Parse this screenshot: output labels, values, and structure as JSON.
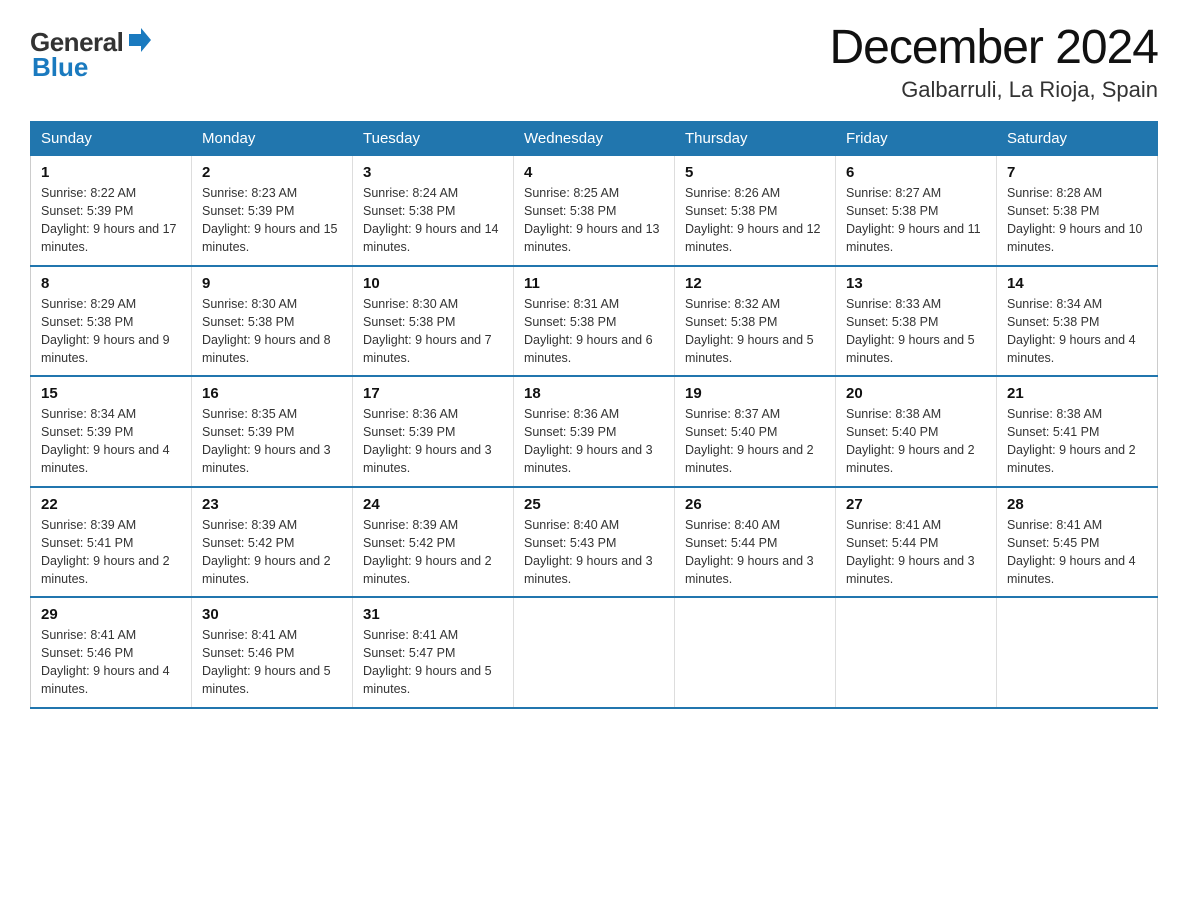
{
  "logo": {
    "general": "General",
    "blue": "Blue",
    "arrow_color": "#1a7abf"
  },
  "title": "December 2024",
  "subtitle": "Galbarruli, La Rioja, Spain",
  "days_of_week": [
    "Sunday",
    "Monday",
    "Tuesday",
    "Wednesday",
    "Thursday",
    "Friday",
    "Saturday"
  ],
  "weeks": [
    [
      {
        "day": "1",
        "sunrise": "8:22 AM",
        "sunset": "5:39 PM",
        "daylight": "9 hours and 17 minutes."
      },
      {
        "day": "2",
        "sunrise": "8:23 AM",
        "sunset": "5:39 PM",
        "daylight": "9 hours and 15 minutes."
      },
      {
        "day": "3",
        "sunrise": "8:24 AM",
        "sunset": "5:38 PM",
        "daylight": "9 hours and 14 minutes."
      },
      {
        "day": "4",
        "sunrise": "8:25 AM",
        "sunset": "5:38 PM",
        "daylight": "9 hours and 13 minutes."
      },
      {
        "day": "5",
        "sunrise": "8:26 AM",
        "sunset": "5:38 PM",
        "daylight": "9 hours and 12 minutes."
      },
      {
        "day": "6",
        "sunrise": "8:27 AM",
        "sunset": "5:38 PM",
        "daylight": "9 hours and 11 minutes."
      },
      {
        "day": "7",
        "sunrise": "8:28 AM",
        "sunset": "5:38 PM",
        "daylight": "9 hours and 10 minutes."
      }
    ],
    [
      {
        "day": "8",
        "sunrise": "8:29 AM",
        "sunset": "5:38 PM",
        "daylight": "9 hours and 9 minutes."
      },
      {
        "day": "9",
        "sunrise": "8:30 AM",
        "sunset": "5:38 PM",
        "daylight": "9 hours and 8 minutes."
      },
      {
        "day": "10",
        "sunrise": "8:30 AM",
        "sunset": "5:38 PM",
        "daylight": "9 hours and 7 minutes."
      },
      {
        "day": "11",
        "sunrise": "8:31 AM",
        "sunset": "5:38 PM",
        "daylight": "9 hours and 6 minutes."
      },
      {
        "day": "12",
        "sunrise": "8:32 AM",
        "sunset": "5:38 PM",
        "daylight": "9 hours and 5 minutes."
      },
      {
        "day": "13",
        "sunrise": "8:33 AM",
        "sunset": "5:38 PM",
        "daylight": "9 hours and 5 minutes."
      },
      {
        "day": "14",
        "sunrise": "8:34 AM",
        "sunset": "5:38 PM",
        "daylight": "9 hours and 4 minutes."
      }
    ],
    [
      {
        "day": "15",
        "sunrise": "8:34 AM",
        "sunset": "5:39 PM",
        "daylight": "9 hours and 4 minutes."
      },
      {
        "day": "16",
        "sunrise": "8:35 AM",
        "sunset": "5:39 PM",
        "daylight": "9 hours and 3 minutes."
      },
      {
        "day": "17",
        "sunrise": "8:36 AM",
        "sunset": "5:39 PM",
        "daylight": "9 hours and 3 minutes."
      },
      {
        "day": "18",
        "sunrise": "8:36 AM",
        "sunset": "5:39 PM",
        "daylight": "9 hours and 3 minutes."
      },
      {
        "day": "19",
        "sunrise": "8:37 AM",
        "sunset": "5:40 PM",
        "daylight": "9 hours and 2 minutes."
      },
      {
        "day": "20",
        "sunrise": "8:38 AM",
        "sunset": "5:40 PM",
        "daylight": "9 hours and 2 minutes."
      },
      {
        "day": "21",
        "sunrise": "8:38 AM",
        "sunset": "5:41 PM",
        "daylight": "9 hours and 2 minutes."
      }
    ],
    [
      {
        "day": "22",
        "sunrise": "8:39 AM",
        "sunset": "5:41 PM",
        "daylight": "9 hours and 2 minutes."
      },
      {
        "day": "23",
        "sunrise": "8:39 AM",
        "sunset": "5:42 PM",
        "daylight": "9 hours and 2 minutes."
      },
      {
        "day": "24",
        "sunrise": "8:39 AM",
        "sunset": "5:42 PM",
        "daylight": "9 hours and 2 minutes."
      },
      {
        "day": "25",
        "sunrise": "8:40 AM",
        "sunset": "5:43 PM",
        "daylight": "9 hours and 3 minutes."
      },
      {
        "day": "26",
        "sunrise": "8:40 AM",
        "sunset": "5:44 PM",
        "daylight": "9 hours and 3 minutes."
      },
      {
        "day": "27",
        "sunrise": "8:41 AM",
        "sunset": "5:44 PM",
        "daylight": "9 hours and 3 minutes."
      },
      {
        "day": "28",
        "sunrise": "8:41 AM",
        "sunset": "5:45 PM",
        "daylight": "9 hours and 4 minutes."
      }
    ],
    [
      {
        "day": "29",
        "sunrise": "8:41 AM",
        "sunset": "5:46 PM",
        "daylight": "9 hours and 4 minutes."
      },
      {
        "day": "30",
        "sunrise": "8:41 AM",
        "sunset": "5:46 PM",
        "daylight": "9 hours and 5 minutes."
      },
      {
        "day": "31",
        "sunrise": "8:41 AM",
        "sunset": "5:47 PM",
        "daylight": "9 hours and 5 minutes."
      },
      null,
      null,
      null,
      null
    ]
  ]
}
